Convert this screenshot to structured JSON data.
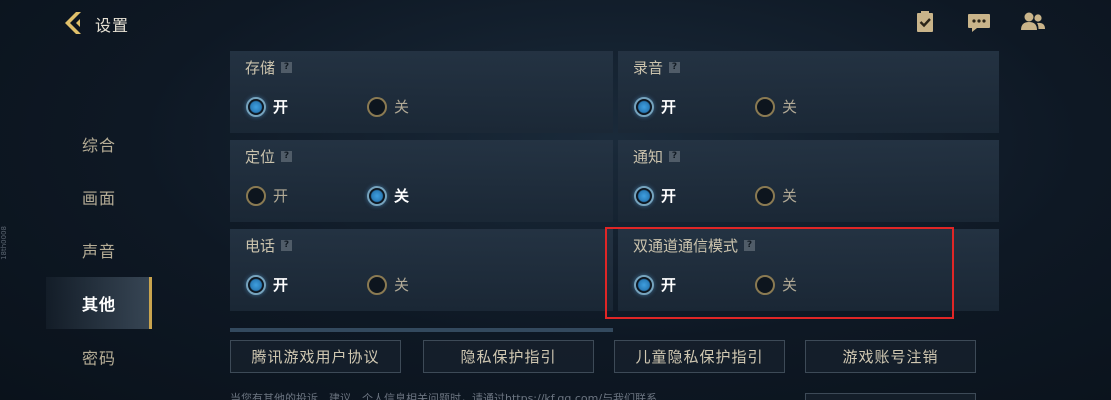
{
  "header": {
    "title": "设置",
    "icons": [
      "back-arrow-icon",
      "clipboard-check-icon",
      "chat-icon",
      "friends-icon"
    ]
  },
  "sidebar": {
    "watermark": "18th0008",
    "items": [
      {
        "label": "综合",
        "active": false
      },
      {
        "label": "画面",
        "active": false
      },
      {
        "label": "声音",
        "active": false
      },
      {
        "label": "其他",
        "active": true
      },
      {
        "label": "密码",
        "active": false
      }
    ]
  },
  "panels": [
    {
      "title": "存储",
      "help": "?",
      "on_label": "开",
      "off_label": "关",
      "selected": "on"
    },
    {
      "title": "录音",
      "help": "?",
      "on_label": "开",
      "off_label": "关",
      "selected": "on"
    },
    {
      "title": "定位",
      "help": "?",
      "on_label": "开",
      "off_label": "关",
      "selected": "off"
    },
    {
      "title": "通知",
      "help": "?",
      "on_label": "开",
      "off_label": "关",
      "selected": "on"
    },
    {
      "title": "电话",
      "help": "?",
      "on_label": "开",
      "off_label": "关",
      "selected": "on"
    },
    {
      "title": "双通道通信模式",
      "help": "?",
      "on_label": "开",
      "off_label": "关",
      "selected": "none"
    }
  ],
  "bottom_buttons": [
    "腾讯游戏用户协议",
    "隐私保护指引",
    "儿童隐私保护指引",
    "游戏账号注销"
  ],
  "notice": "当您有其他的投诉、建议、个人信息相关问题时，请通过https://kf.qq.com/与我们联系",
  "colors": {
    "accent_gold": "#c9a44e",
    "radio_selected": "#3f9fe0",
    "highlight_border": "#e02626",
    "panel_bg": "#22344a"
  }
}
